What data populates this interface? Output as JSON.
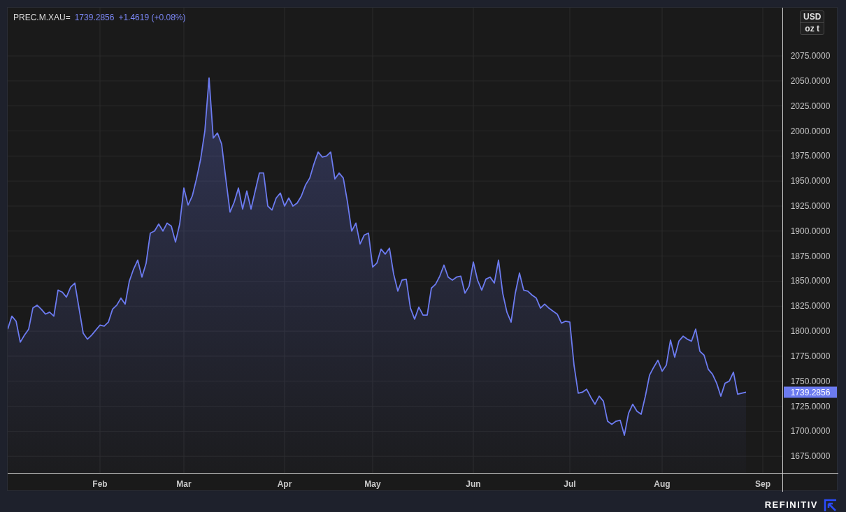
{
  "header": {
    "price": "1739.2856",
    "change": "+1.4619 (+0.08%)"
  },
  "units": [
    "USD",
    "oz t"
  ],
  "chart": {
    "chart_data": {
      "type": "area",
      "grid": true,
      "categories": [
        null,
        null,
        null,
        null,
        null,
        null,
        null,
        null,
        null,
        null,
        null,
        null,
        null,
        null,
        null,
        null,
        null,
        null,
        null,
        null,
        null,
        null,
        "Feb",
        null,
        null,
        null,
        null,
        null,
        null,
        null,
        null,
        null,
        null,
        null,
        null,
        null,
        null,
        null,
        null,
        null,
        null,
        null,
        "Mar",
        null,
        null,
        null,
        null,
        null,
        null,
        null,
        null,
        null,
        null,
        null,
        null,
        null,
        null,
        null,
        null,
        null,
        null,
        null,
        null,
        null,
        null,
        null,
        "Apr",
        null,
        null,
        null,
        null,
        null,
        null,
        null,
        null,
        null,
        null,
        null,
        null,
        null,
        null,
        null,
        null,
        null,
        null,
        null,
        null,
        "May",
        null,
        null,
        null,
        null,
        null,
        null,
        null,
        null,
        null,
        null,
        null,
        null,
        null,
        null,
        null,
        null,
        null,
        null,
        null,
        null,
        null,
        null,
        null,
        "Jun",
        null,
        null,
        null,
        null,
        null,
        null,
        null,
        null,
        null,
        null,
        null,
        null,
        null,
        null,
        null,
        null,
        null,
        null,
        null,
        null,
        null,
        null,
        "Jul",
        null,
        null,
        null,
        null,
        null,
        null,
        null,
        null,
        null,
        null,
        null,
        null,
        null,
        null,
        null,
        null,
        null,
        null,
        null,
        null,
        null,
        "Aug",
        null,
        null,
        null,
        null,
        null,
        null,
        null,
        null,
        null,
        null,
        null,
        null,
        null,
        null,
        null,
        null,
        null,
        null,
        null,
        null,
        null,
        null,
        null,
        "Sep"
      ],
      "ylim": [
        1658.4,
        2123.2
      ],
      "yticks": [
        {
          "value": 2075,
          "label": "2075.0000"
        },
        {
          "value": 2050,
          "label": "2050.0000"
        },
        {
          "value": 2025,
          "label": "2025.0000"
        },
        {
          "value": 2000,
          "label": "2000.0000"
        },
        {
          "value": 1975,
          "label": "1975.0000"
        },
        {
          "value": 1950,
          "label": "1950.0000"
        },
        {
          "value": 1925,
          "label": "1925.0000"
        },
        {
          "value": 1900,
          "label": "1900.0000"
        },
        {
          "value": 1875,
          "label": "1875.0000"
        },
        {
          "value": 1850,
          "label": "1850.0000"
        },
        {
          "value": 1825,
          "label": "1825.0000"
        },
        {
          "value": 1800,
          "label": "1800.0000"
        },
        {
          "value": 1775,
          "label": "1775.0000"
        },
        {
          "value": 1750,
          "label": "1750.0000"
        },
        {
          "value": 1725,
          "label": "1725.0000"
        },
        {
          "value": 1700,
          "label": "1700.0000"
        },
        {
          "value": 1675,
          "label": "1675.0000"
        }
      ],
      "series": [
        {
          "name": "PREC.M.XAU=",
          "color": "#6c7bf0",
          "values": [
            1802,
            1815,
            1810,
            1789,
            1796,
            1802,
            1823,
            1826,
            1822,
            1817,
            1819,
            1815,
            1841,
            1839,
            1834,
            1844,
            1848,
            1823,
            1798,
            1792,
            1796,
            1801,
            1806,
            1805,
            1809,
            1822,
            1826,
            1833,
            1827,
            1850,
            1862,
            1871,
            1854,
            1868,
            1898,
            1900,
            1907,
            1900,
            1908,
            1905,
            1889,
            1907,
            1943,
            1926,
            1935,
            1952,
            1972,
            2000,
            2053,
            1993,
            1998,
            1987,
            1952,
            1919,
            1929,
            1943,
            1922,
            1940,
            1922,
            1940,
            1958,
            1958,
            1925,
            1921,
            1933,
            1938,
            1925,
            1933,
            1925,
            1928,
            1935,
            1946,
            1953,
            1967,
            1979,
            1974,
            1975,
            1979,
            1952,
            1958,
            1953,
            1929,
            1900,
            1908,
            1887,
            1896,
            1898,
            1864,
            1868,
            1882,
            1877,
            1883,
            1857,
            1840,
            1851,
            1852,
            1823,
            1812,
            1824,
            1816,
            1816,
            1843,
            1847,
            1855,
            1866,
            1854,
            1851,
            1854,
            1855,
            1838,
            1845,
            1869,
            1851,
            1841,
            1852,
            1854,
            1848,
            1871,
            1838,
            1819,
            1809,
            1838,
            1858,
            1841,
            1840,
            1836,
            1833,
            1823,
            1827,
            1823,
            1820,
            1817,
            1808,
            1810,
            1809,
            1766,
            1738,
            1739,
            1742,
            1734,
            1727,
            1735,
            1730,
            1710,
            1707,
            1710,
            1711,
            1696,
            1718,
            1727,
            1720,
            1717,
            1735,
            1756,
            1764,
            1771,
            1760,
            1766,
            1791,
            1774,
            1790,
            1795,
            1792,
            1790,
            1802,
            1780,
            1776,
            1762,
            1757,
            1748,
            1735,
            1748,
            1750,
            1759,
            1737,
            1738,
            1739,
            null,
            null,
            null,
            null
          ]
        }
      ]
    },
    "last_value_label": "1739.2856"
  },
  "footer": {
    "brand": "REFINITIV"
  }
}
